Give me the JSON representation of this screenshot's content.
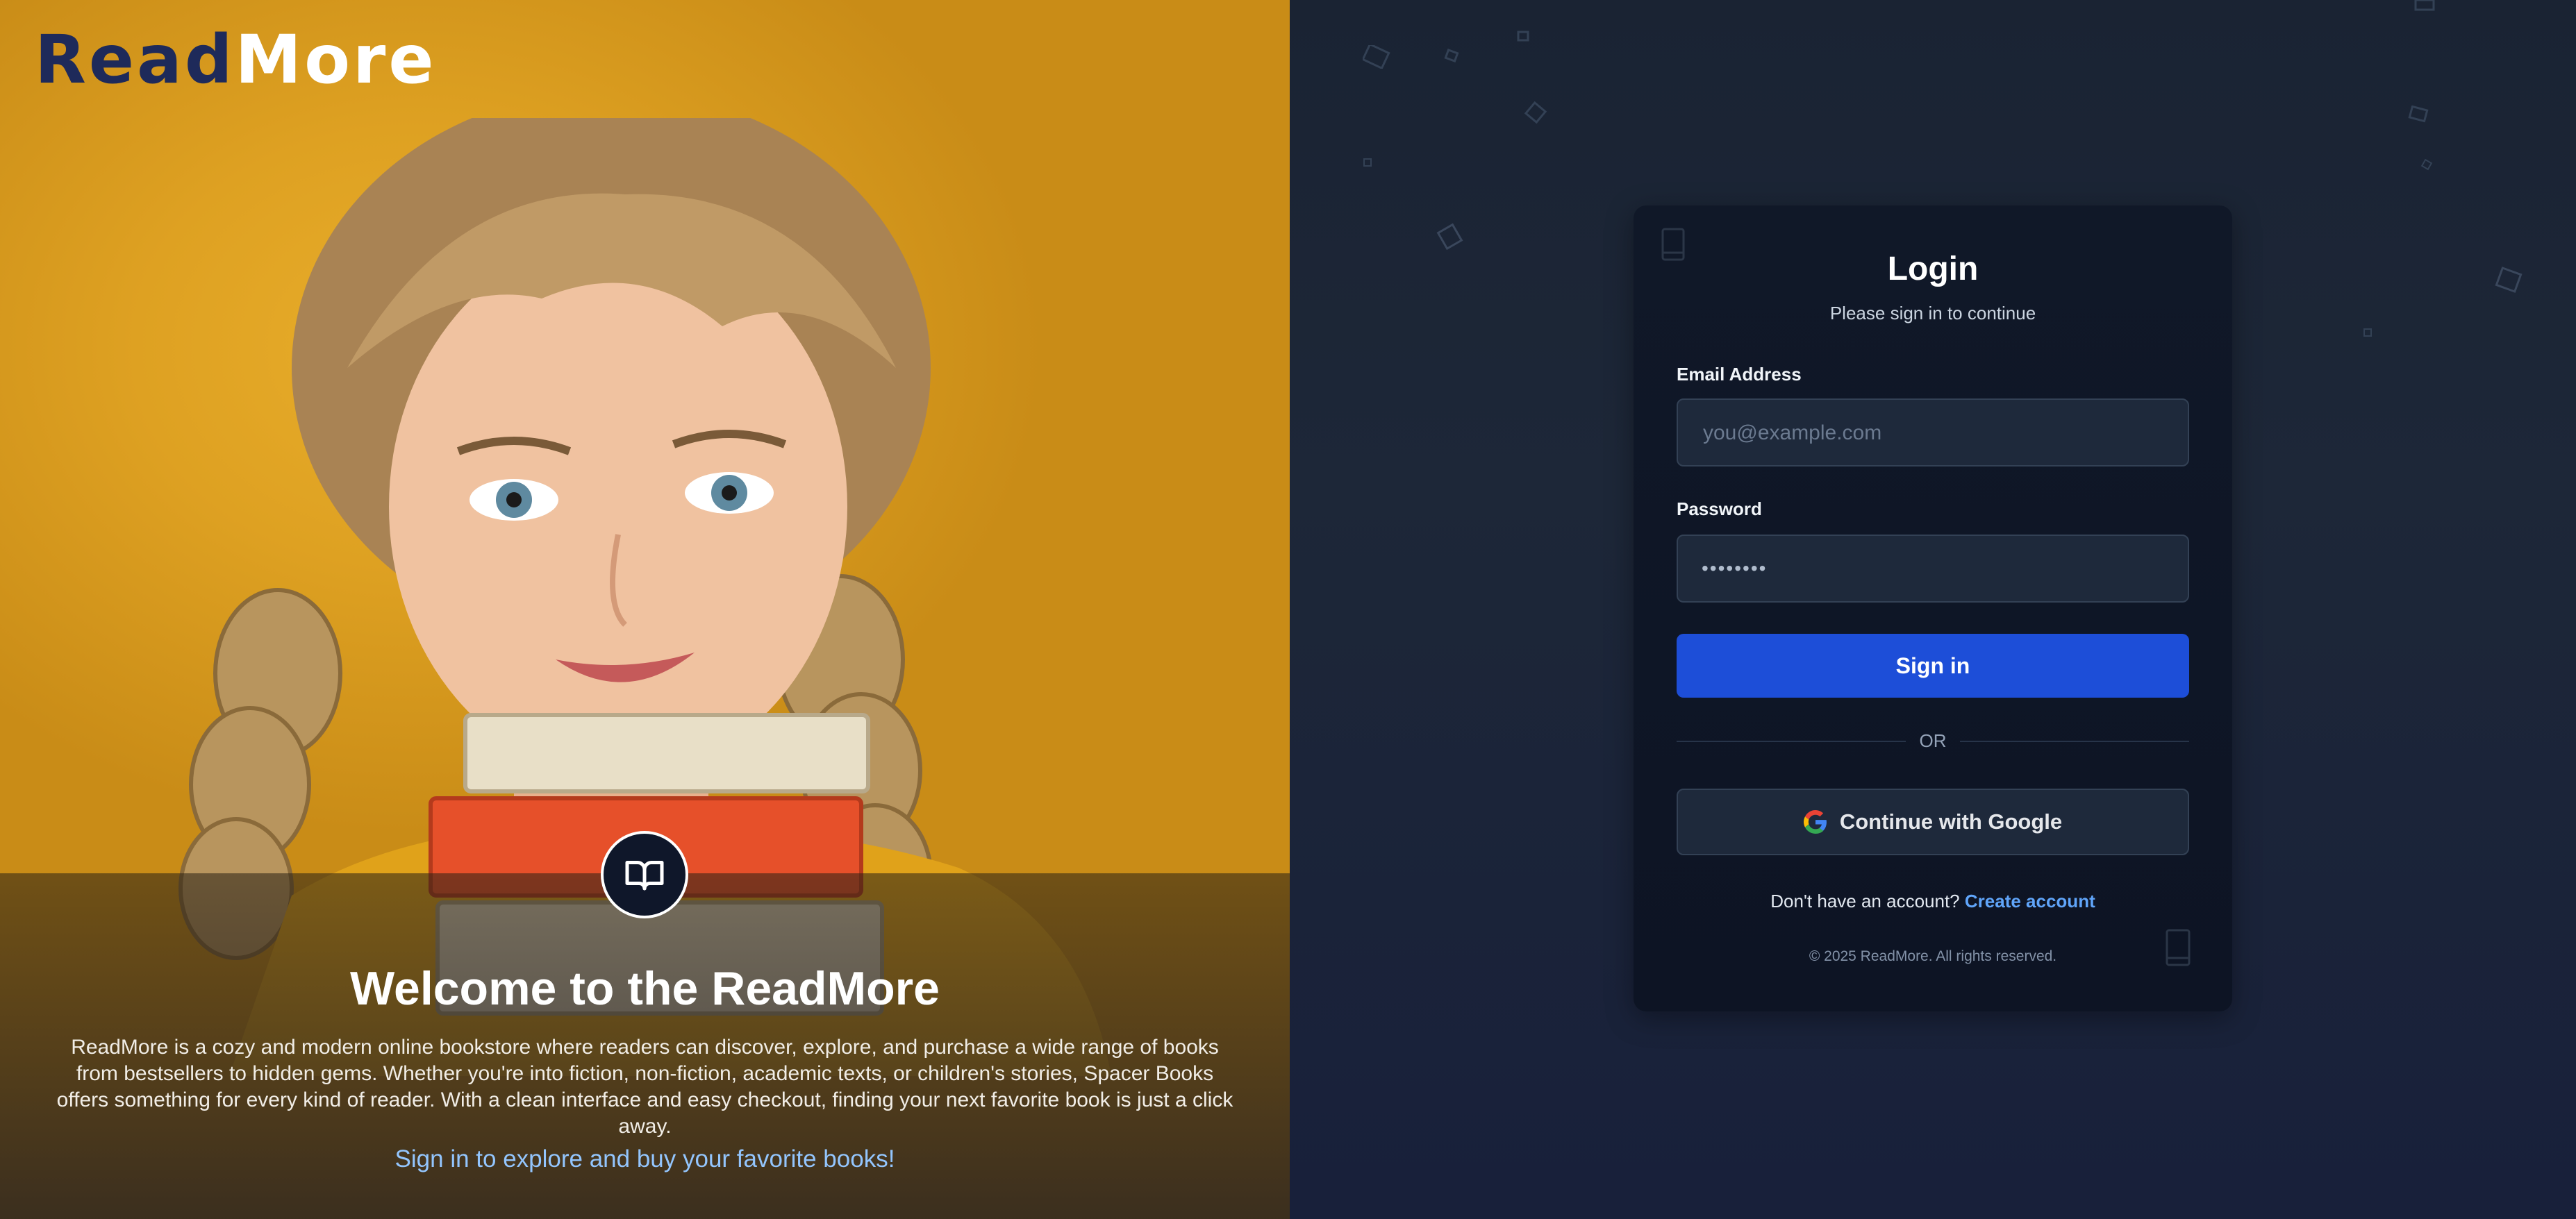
{
  "brand": {
    "part1": "Read",
    "part2": "More"
  },
  "hero": {
    "icon": "open-book-icon",
    "title": "Welcome to the ReadMore",
    "description": "ReadMore is a cozy and modern online bookstore where readers can discover, explore, and purchase a wide range of books from bestsellers to hidden gems. Whether you're into fiction, non-fiction, academic texts, or children's stories, Spacer Books offers something for every kind of reader. With a clean interface and easy checkout, finding your next favorite book is just a click away.",
    "cta": "Sign in to explore and buy your favorite books!"
  },
  "login": {
    "title": "Login",
    "subtitle": "Please sign in to continue",
    "email_label": "Email Address",
    "email_placeholder": "you@example.com",
    "password_label": "Password",
    "password_value": "••••••••",
    "signin_label": "Sign in",
    "or_text": "OR",
    "google_label": "Continue with Google",
    "signup_prompt": "Don't have an account?",
    "signup_link": "Create account",
    "copyright": "© 2025 ReadMore. All rights reserved."
  },
  "colors": {
    "hero_bg": "#dea122",
    "brand_dark": "#1e2a5a",
    "panel_bg": "#1b2434",
    "card_bg": "#0f1727",
    "primary": "#1d4ed8",
    "link": "#60a5fa"
  }
}
